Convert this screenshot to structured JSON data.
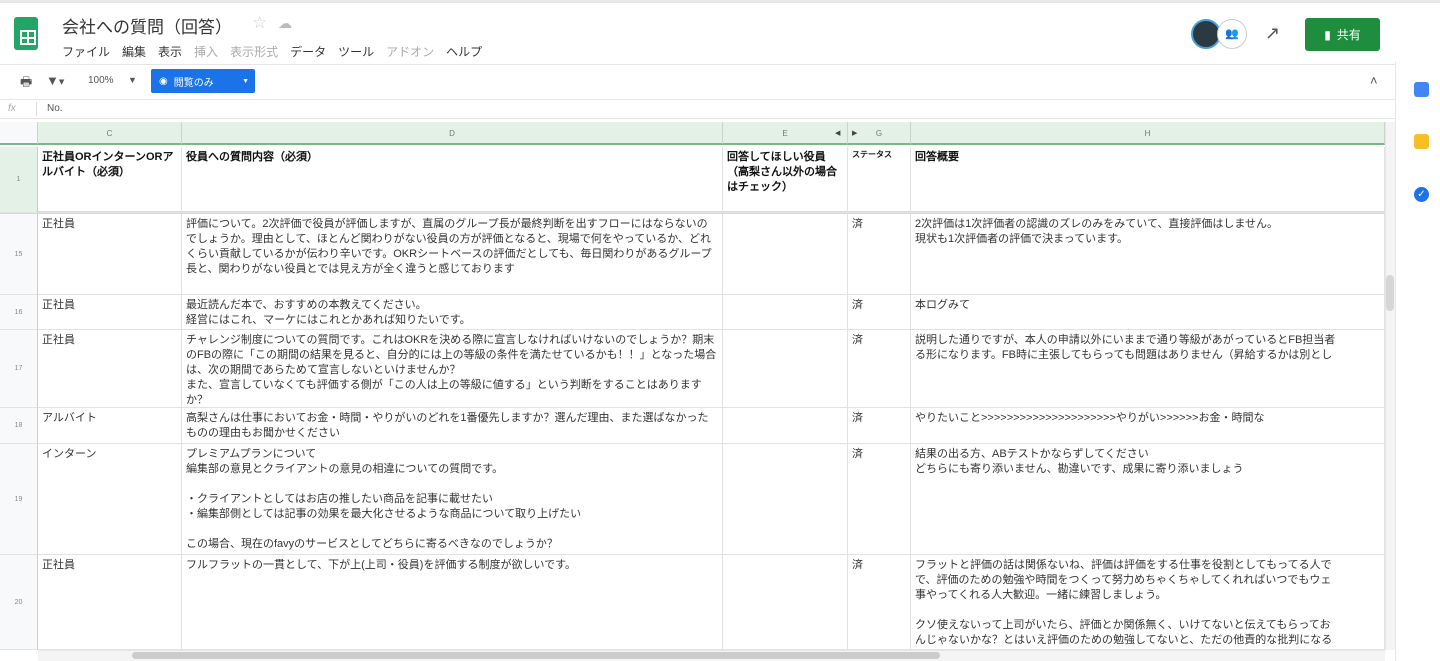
{
  "header": {
    "title": "会社への質問（回答）",
    "menu": [
      {
        "label": "ファイル",
        "enabled": true
      },
      {
        "label": "編集",
        "enabled": true
      },
      {
        "label": "表示",
        "enabled": true
      },
      {
        "label": "挿入",
        "enabled": false
      },
      {
        "label": "表示形式",
        "enabled": false
      },
      {
        "label": "データ",
        "enabled": true
      },
      {
        "label": "ツール",
        "enabled": true
      },
      {
        "label": "アドオン",
        "enabled": false
      },
      {
        "label": "ヘルプ",
        "enabled": true
      }
    ],
    "share_label": "共有",
    "colors": {
      "brand": "#23a566",
      "share": "#1e8e3e",
      "accent": "#1a73e8"
    }
  },
  "toolbar": {
    "zoom": "100%",
    "mode_label": "閲覧のみ"
  },
  "formula_bar": {
    "fx": "fx",
    "value": "No."
  },
  "columns": [
    "C",
    "D",
    "E",
    "G",
    "H"
  ],
  "header_row": {
    "row_number": "1",
    "cells": [
      "正社員ORインターンORアルバイト（必須）",
      "役員への質問内容（必須）",
      "回答してほしい役員（高梨さん以外の場合はチェック）",
      "ステータス",
      "回答概要"
    ]
  },
  "rows": [
    {
      "row_number": "15",
      "cells": [
        "正社員",
        "評価について。2次評価で役員が評価しますが、直属のグループ長が最終判断を出すフローにはならないのでしょうか。理由として、ほとんど関わりがない役員の方が評価となると、現場で何をやっているか、どれくらい貢献しているかが伝わり辛いです。OKRシートベースの評価だとしても、毎日関わりがあるグループ長と、関わりがない役員とでは見え方が全く違うと感じております",
        "",
        "済",
        "2次評価は1次評価者の認識のズレのみをみていて、直接評価はしません。\n現状も1次評価者の評価で決まっています。"
      ]
    },
    {
      "row_number": "16",
      "cells": [
        "正社員",
        "最近読んだ本で、おすすめの本教えてください。\n経営にはこれ、マーケにはこれとかあれば知りたいです。",
        "",
        "済",
        "本ログみて"
      ]
    },
    {
      "row_number": "17",
      "cells": [
        "正社員",
        "チャレンジ制度についての質問です。これはOKRを決める際に宣言しなければいけないのでしょうか？期末のFBの際に「この期間の結果を見ると、自分的には上の等級の条件を満たせているかも！！」となった場合は、次の期間であらためて宣言しないといけませんか？\nまた、宣言していなくても評価する側が「この人は上の等級に値する」という判断をすることはありますか？",
        "",
        "済",
        "説明した通りですが、本人の申請以外にいままで通り等級があがっているとFB担当者\nる形になります。FB時に主張してもらっても問題はありません（昇給するかは別とし"
      ]
    },
    {
      "row_number": "18",
      "cells": [
        "アルバイト",
        "高梨さんは仕事においてお金・時間・やりがいのどれを1番優先しますか？選んだ理由、また選ばなかったものの理由もお聞かせください",
        "",
        "済",
        "やりたいこと>>>>>>>>>>>>>>>>>>>>>やりがい>>>>>>お金・時間な"
      ]
    },
    {
      "row_number": "19",
      "cells": [
        "インターン",
        "プレミアムプランについて\n編集部の意見とクライアントの意見の相違についての質問です。\n\n・クライアントとしてはお店の推したい商品を記事に載せたい\n・編集部側としては記事の効果を最大化させるような商品について取り上げたい\n\nこの場合、現在のfavyのサービスとしてどちらに寄るべきなのでしょうか？",
        "",
        "済",
        "結果の出る方、ABテストかならずしてください\nどちらにも寄り添いません、勘違いです、成果に寄り添いましょう"
      ]
    },
    {
      "row_number": "20",
      "cells": [
        "正社員",
        "フルフラットの一貫として、下が上(上司・役員)を評価する制度が欲しいです。",
        "",
        "済",
        "フラットと評価の話は関係ないね、評価は評価をする仕事を役割としてもってる人で\nで、評価のための勉強や時間をつくって努力めちゃくちゃしてくれればいつでもウェ\n事やってくれる人大歓迎。一緒に練習しましょう。\n\nクソ使えないって上司がいたら、評価とか関係無く、いけてないと伝えてもらってお\nんじゃないかな？とはいえ評価のための勉強してないと、ただの他責的な批判になる"
      ]
    }
  ]
}
